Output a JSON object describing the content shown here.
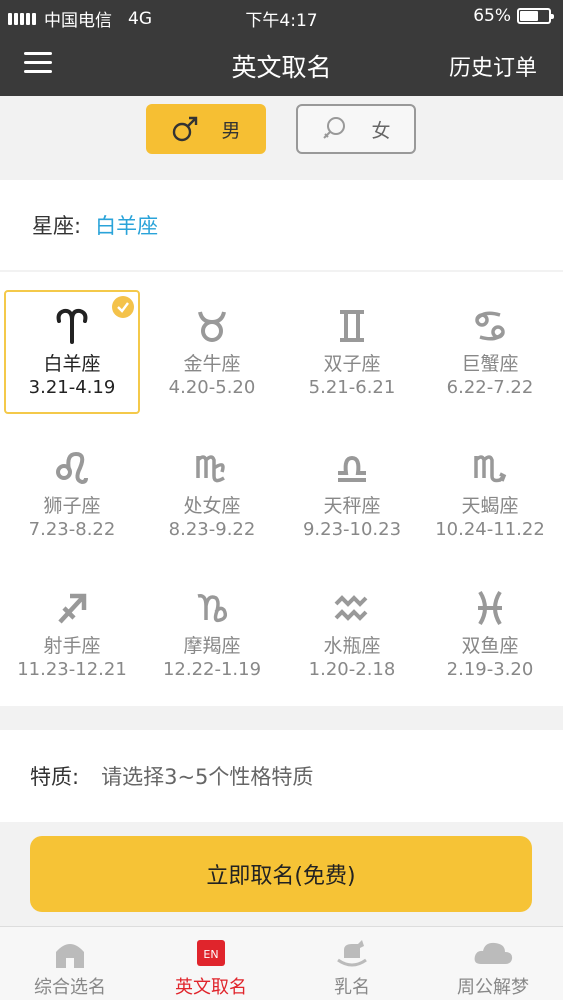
{
  "status_bar": {
    "carrier": "中国电信",
    "network": "4G",
    "time": "下午4:17",
    "battery_percent": "65%",
    "battery_level": 0.65
  },
  "nav": {
    "title": "英文取名",
    "history_label": "历史订单"
  },
  "gender": {
    "male_label": "男",
    "female_label": "女",
    "selected": "male"
  },
  "constellation": {
    "label": "星座:",
    "value": "白羊座"
  },
  "zodiac": [
    {
      "name": "白羊座",
      "dates": "3.21-4.19",
      "icon": "aries-icon",
      "selected": true
    },
    {
      "name": "金牛座",
      "dates": "4.20-5.20",
      "icon": "taurus-icon"
    },
    {
      "name": "双子座",
      "dates": "5.21-6.21",
      "icon": "gemini-icon"
    },
    {
      "name": "巨蟹座",
      "dates": "6.22-7.22",
      "icon": "cancer-icon"
    },
    {
      "name": "狮子座",
      "dates": "7.23-8.22",
      "icon": "leo-icon"
    },
    {
      "name": "处女座",
      "dates": "8.23-9.22",
      "icon": "virgo-icon"
    },
    {
      "name": "天秤座",
      "dates": "9.23-10.23",
      "icon": "libra-icon"
    },
    {
      "name": "天蝎座",
      "dates": "10.24-11.22",
      "icon": "scorpio-icon"
    },
    {
      "name": "射手座",
      "dates": "11.23-12.21",
      "icon": "sagittarius-icon"
    },
    {
      "name": "摩羯座",
      "dates": "12.22-1.19",
      "icon": "capricorn-icon"
    },
    {
      "name": "水瓶座",
      "dates": "1.20-2.18",
      "icon": "aquarius-icon"
    },
    {
      "name": "双鱼座",
      "dates": "2.19-3.20",
      "icon": "pisces-icon"
    }
  ],
  "traits": {
    "label": "特质:",
    "placeholder": "请选择3~5个性格特质"
  },
  "cta": {
    "label": "立即取名(免费)"
  },
  "tabs": [
    {
      "label": "综合选名",
      "icon": "house-icon"
    },
    {
      "label": "英文取名",
      "icon": "en-badge-icon",
      "badge": "EN",
      "active": true
    },
    {
      "label": "乳名",
      "icon": "rocking-horse-icon"
    },
    {
      "label": "周公解梦",
      "icon": "cloud-icon"
    }
  ],
  "colors": {
    "accent": "#f6c336",
    "link": "#2aa3d9",
    "active_tab": "#e0252c",
    "bar": "#3a3a3a"
  }
}
